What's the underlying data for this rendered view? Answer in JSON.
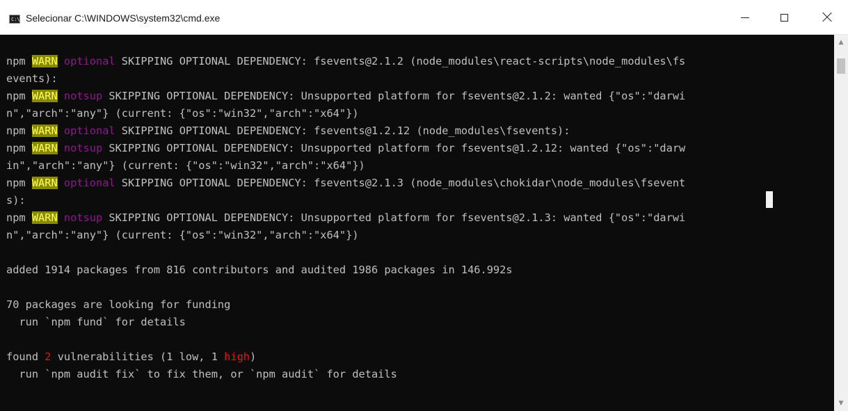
{
  "window": {
    "title": "Selecionar C:\\WINDOWS\\system32\\cmd.exe",
    "icon": "cmd-icon",
    "icon_text": "C:\\",
    "buttons": {
      "minimize": "minimize-icon",
      "maximize": "maximize-icon",
      "close": "close-icon"
    }
  },
  "colors": {
    "console_bg": "#0c0c0c",
    "text": "#c0c0c0",
    "warn_bg": "#8a8a00",
    "warn_fg": "#ffff55",
    "magenta": "#8b1a8b",
    "red": "#e81313",
    "cursor": "#f2f2f2"
  },
  "console": {
    "lines": [
      [
        {
          "t": "npm "
        },
        {
          "t": "WARN",
          "c": "warn"
        },
        {
          "t": " "
        },
        {
          "t": "optional",
          "c": "mag"
        },
        {
          "t": " SKIPPING OPTIONAL DEPENDENCY: fsevents@2.1.2 (node_modules\\react-scripts\\node_modules\\fs"
        }
      ],
      [
        {
          "t": "events):"
        }
      ],
      [
        {
          "t": "npm "
        },
        {
          "t": "WARN",
          "c": "warn"
        },
        {
          "t": " "
        },
        {
          "t": "notsup",
          "c": "mag"
        },
        {
          "t": " SKIPPING OPTIONAL DEPENDENCY: Unsupported platform for fsevents@2.1.2: wanted {\"os\":\"darwi"
        }
      ],
      [
        {
          "t": "n\",\"arch\":\"any\"} (current: {\"os\":\"win32\",\"arch\":\"x64\"})"
        }
      ],
      [
        {
          "t": "npm "
        },
        {
          "t": "WARN",
          "c": "warn"
        },
        {
          "t": " "
        },
        {
          "t": "optional",
          "c": "mag"
        },
        {
          "t": " SKIPPING OPTIONAL DEPENDENCY: fsevents@1.2.12 (node_modules\\fsevents):"
        }
      ],
      [
        {
          "t": "npm "
        },
        {
          "t": "WARN",
          "c": "warn"
        },
        {
          "t": " "
        },
        {
          "t": "notsup",
          "c": "mag"
        },
        {
          "t": " SKIPPING OPTIONAL DEPENDENCY: Unsupported platform for fsevents@1.2.12: wanted {\"os\":\"darw"
        }
      ],
      [
        {
          "t": "in\",\"arch\":\"any\"} (current: {\"os\":\"win32\",\"arch\":\"x64\"})"
        }
      ],
      [
        {
          "t": "npm "
        },
        {
          "t": "WARN",
          "c": "warn"
        },
        {
          "t": " "
        },
        {
          "t": "optional",
          "c": "mag"
        },
        {
          "t": " SKIPPING OPTIONAL DEPENDENCY: fsevents@2.1.3 (node_modules\\chokidar\\node_modules\\fsevent"
        }
      ],
      [
        {
          "t": "s):"
        }
      ],
      [
        {
          "t": "npm "
        },
        {
          "t": "WARN",
          "c": "warn"
        },
        {
          "t": " "
        },
        {
          "t": "notsup",
          "c": "mag"
        },
        {
          "t": " SKIPPING OPTIONAL DEPENDENCY: Unsupported platform for fsevents@2.1.3: wanted {\"os\":\"darwi"
        }
      ],
      [
        {
          "t": "n\",\"arch\":\"any\"} (current: {\"os\":\"win32\",\"arch\":\"x64\"})"
        }
      ],
      [],
      [
        {
          "t": "added 1914 packages from 816 contributors and audited 1986 packages in 146.992s"
        }
      ],
      [],
      [
        {
          "t": "70 packages are looking for funding"
        }
      ],
      [
        {
          "t": "  run `npm fund` for details"
        }
      ],
      [],
      [
        {
          "t": "found "
        },
        {
          "t": "2",
          "c": "red"
        },
        {
          "t": " vulnerabilities (1 low, 1 "
        },
        {
          "t": "high",
          "c": "red"
        },
        {
          "t": ")"
        }
      ],
      [
        {
          "t": "  run `npm audit fix` to fix them, or `npm audit` for details"
        }
      ]
    ]
  },
  "scrollbar": {
    "up_icon": "scroll-up-arrow-icon",
    "down_icon": "scroll-down-arrow-icon"
  }
}
